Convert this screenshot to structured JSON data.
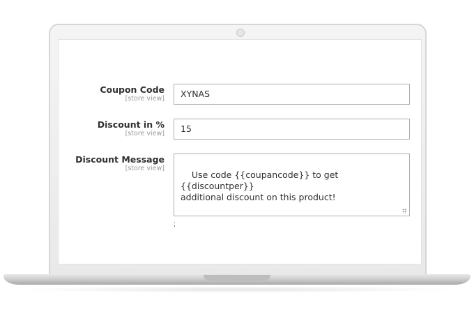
{
  "form": {
    "coupon_code": {
      "label": "Coupon Code",
      "scope": "[store view]",
      "value": "XYNAS"
    },
    "discount_percent": {
      "label": "Discount in %",
      "scope": "[store view]",
      "value": "15"
    },
    "discount_message": {
      "label": "Discount Message",
      "scope": "[store view]",
      "value": "Use code {{coupancode}} to get {{discountper}}\nadditional discount on this product!"
    }
  },
  "note_mark": ";"
}
